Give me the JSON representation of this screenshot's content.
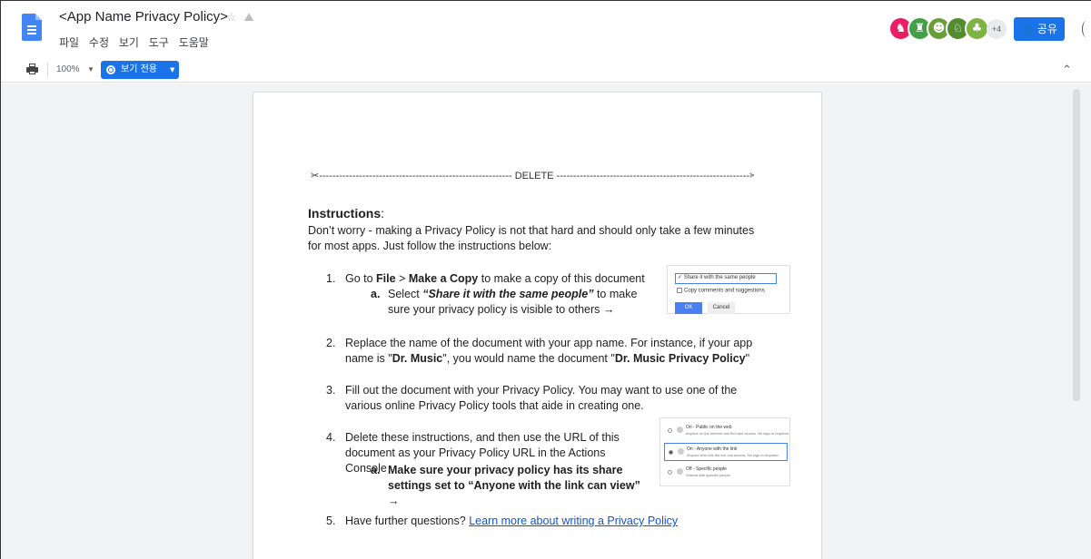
{
  "header": {
    "title": "<App Name Privacy Policy>",
    "star_icon": "star-icon",
    "move_icon": "move-to-drive-icon",
    "menu": [
      "파일",
      "수정",
      "보기",
      "도구",
      "도움말"
    ],
    "avatar_colors": [
      "#e91e63",
      "#43a047",
      "#689f38",
      "#558b2f",
      "#7cb342"
    ],
    "more_count": "+4",
    "share_label": "공유"
  },
  "toolbar": {
    "zoom": "100%",
    "mode_label": "보기 전용"
  },
  "document": {
    "delete_line": "✂---------------------------------------------------------- DELETE ----------------------------------------------------------✂",
    "instructions_heading": "Instructions",
    "instructions_colon": ":",
    "intro": "Don’t worry - making a Privacy Policy is not that hard and should only take a few minutes for most apps. Just follow the instructions below:",
    "steps": {
      "s1": {
        "num": "1.",
        "pre": "Go to ",
        "file": "File",
        "gt": " > ",
        "make_copy": "Make a Copy",
        "post": " to make a copy of this document",
        "sub_letter": "a.",
        "sub_pre": "Select ",
        "sub_bold": "“Share it with the same people”",
        "sub_post": " to make sure your privacy policy is visible to others →"
      },
      "s2": {
        "num": "2.",
        "pre": "Replace the name of the document with your app name. For instance, if your app name is \"",
        "b1": "Dr. Music",
        "mid": "\", you would name the document \"",
        "b2": "Dr. Music Privacy Policy",
        "post": "\""
      },
      "s3": {
        "num": "3.",
        "text": "Fill out the document with your Privacy Policy. You may want to use one of the various online Privacy Policy tools that aide in creating one."
      },
      "s4": {
        "num": "4.",
        "text": "Delete these instructions, and then use the URL of this document as your Privacy Policy URL in the Actions Console",
        "sub_letter": "a.",
        "sub_bold": "Make sure your privacy policy has its share settings set to “Anyone with the link can view”",
        "sub_arrow": " →"
      },
      "s5": {
        "num": "5.",
        "pre": "Have further questions? ",
        "link": "Learn more about writing a Privacy Policy"
      }
    },
    "copy_dialog": {
      "opt1": "Share it with the same people",
      "opt2": "Copy comments and suggestions",
      "ok": "OK",
      "cancel": "Cancel"
    },
    "share_dialog": {
      "o1_title": "On - Public on the web",
      "o1_desc": "Anyone on the Internet can find and access. No sign-in required.",
      "o2_title": "On - Anyone with the link",
      "o2_desc": "Anyone who has the link can access. No sign-in required.",
      "o3_title": "Off - Specific people",
      "o3_desc": "Shared with specific people."
    }
  }
}
